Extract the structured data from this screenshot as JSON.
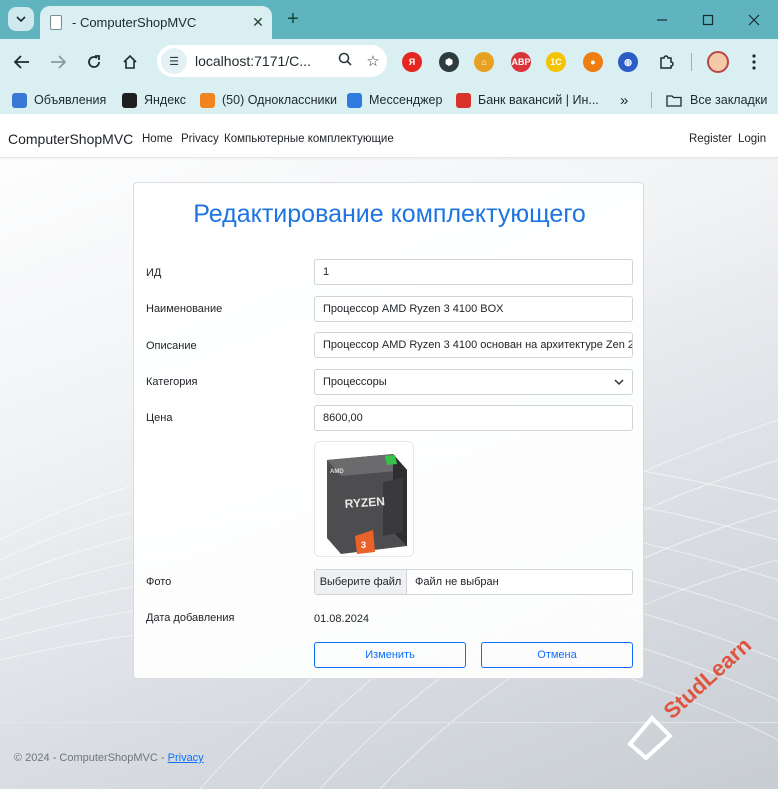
{
  "browser": {
    "tab_title": "- ComputerShopMVC",
    "address": "localhost:7171/C...",
    "extensions": [
      {
        "icon": "yandex-icon",
        "label": "Я",
        "color": "#e52620"
      },
      {
        "icon": "shield-icon",
        "label": "⬢",
        "color": "#2d3a3e"
      },
      {
        "icon": "home-colored-icon",
        "label": "⌂",
        "color": "#e8a020"
      },
      {
        "icon": "adblock-icon",
        "label": "ABP",
        "color": "#d8343a"
      },
      {
        "icon": "1c-icon",
        "label": "1С",
        "color": "#f5c400"
      },
      {
        "icon": "firefox-like-icon",
        "label": "●",
        "color": "#ef7d12"
      },
      {
        "icon": "globe-icon",
        "label": "◍",
        "color": "#2c5cc5"
      }
    ],
    "bookmarks": [
      {
        "icon": "doc-icon",
        "label": "Объявления",
        "color": "#3a78d4"
      },
      {
        "icon": "yandex-star-icon",
        "label": "Яндекс",
        "color": "#1f1f1f"
      },
      {
        "icon": "odnoklassniki-icon",
        "label": "(50) Одноклассники",
        "color": "#f0841e"
      },
      {
        "icon": "messenger-icon",
        "label": "Мессенджер",
        "color": "#2e7be0"
      },
      {
        "icon": "hh-icon",
        "label": "Банк вакансий | Ин...",
        "color": "#d9342b"
      }
    ],
    "overflow_label": "»",
    "all_bookmarks": "Все закладки"
  },
  "navbar": {
    "brand": "ComputerShopMVC",
    "links": [
      "Home",
      "Privacy",
      "Компьютерные комплектующие"
    ],
    "register": "Register",
    "login": "Login"
  },
  "form": {
    "title": "Редактирование комплектующего",
    "id_label": "ИД",
    "id_value": "1",
    "name_label": "Наименование",
    "name_value": "Процессор AMD Ryzen 3 4100 BOX",
    "desc_label": "Описание",
    "desc_value": "Процессор AMD Ryzen 3 4100 основан на архитектуре Zen 2,",
    "category_label": "Категория",
    "category_value": "Процессоры",
    "price_label": "Цена",
    "price_value": "8600,00",
    "photo_label": "Фото",
    "file_button": "Выберите файл",
    "file_status": "Файл не выбран",
    "date_label": "Дата добавления",
    "date_value": "01.08.2024",
    "submit_label": "Изменить",
    "cancel_label": "Отмена",
    "photo_box_text": "RYZEN",
    "photo_box_brand": "AMD",
    "photo_box_number": "3"
  },
  "footer": {
    "text": "© 2024 - ComputerShopMVC - ",
    "privacy": "Privacy"
  },
  "watermark": "StudLearn"
}
